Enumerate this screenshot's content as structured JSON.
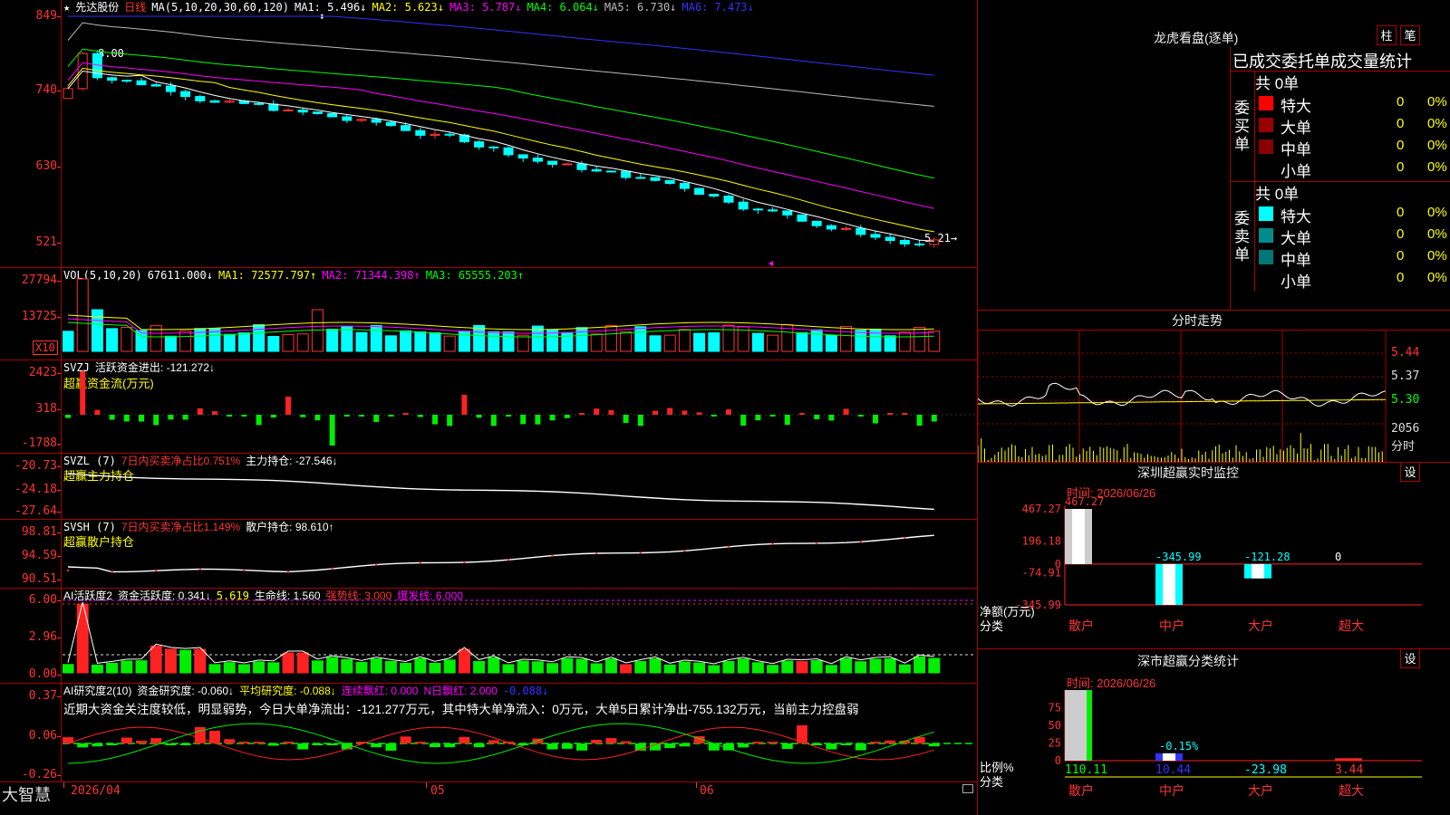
{
  "app": {
    "logo": "大智慧"
  },
  "main": {
    "star": "★",
    "stock": "先达股份",
    "period": "日线",
    "ma_def": "MA(5,10,20,30,60,120)",
    "ma1": "MA1: 5.496↓",
    "ma2": "MA2: 5.623↓",
    "ma3": "MA3: 5.787↓",
    "ma4": "MA4: 6.064↓",
    "ma5": "MA5: 6.730↓",
    "ma6": "MA6: 7.473↓",
    "y_labels": [
      "849",
      "740",
      "630",
      "521"
    ],
    "hi_label": "8.00",
    "lo_label": "5.21→",
    "marker": "⬍"
  },
  "vol": {
    "def": "VOL(5,10,20)",
    "cur": "67611.000↓",
    "ma1": "MA1: 72577.797↑",
    "ma2": "MA2: 71344.398↑",
    "ma3": "MA3: 65555.203↑",
    "y_labels": [
      "27794",
      "13725"
    ],
    "unit": "X10"
  },
  "svzj": {
    "def": "SVZJ",
    "label": "活跃资金进出: -121.272↓",
    "sub": "超赢资金流(万元)",
    "y_labels": [
      "2423",
      "318",
      "-1788"
    ]
  },
  "svzl": {
    "def": "SVZL (7)",
    "ratio": "7日内买卖净占比0.751%",
    "hold": "主力持仓: -27.546↓",
    "sub": "超赢主力持仓",
    "y_labels": [
      "-20.73",
      "-24.18",
      "-27.64"
    ]
  },
  "svsh": {
    "def": "SVSH (7)",
    "ratio": "7日内买卖净占比1.149%",
    "hold": "散户持仓: 98.610↑",
    "sub": "超赢散户持仓",
    "y_labels": [
      "98.81",
      "94.59",
      "90.51"
    ]
  },
  "ai1": {
    "def": "AI活跃度2",
    "a": "资金活跃度: 0.341↓",
    "b": "5.619",
    "c": "生命线: 1.560",
    "d": "强势线: 3.000",
    "e": "爆发线: 6.000",
    "y_labels": [
      "6.00",
      "2.96",
      "0.00"
    ]
  },
  "ai2": {
    "def": "AI研究度2(10)",
    "a": "资金研究度: -0.060↓",
    "b": "平均研究度: -0.088↓",
    "c": "连续飘红: 0.000",
    "d": "N日飘红: 2.000",
    "e": "-0.088↓",
    "comment": "近期大资金关注度较低，明显弱势，今日大单净流出：-121.277万元，其中特大单净流入：0万元，大单5日累计净出-755.132万元，当前主力控盘弱",
    "y_labels": [
      "0.37",
      "0.06",
      "-0.26"
    ]
  },
  "xaxis": {
    "labels": [
      "2026/04",
      "05",
      "06"
    ]
  },
  "right": {
    "lhb": {
      "title": "龙虎看盘(逐单)",
      "btn1": "柱",
      "btn2": "笔",
      "header": "已成交委托单成交量统计",
      "buy_side": "委买单",
      "sell_side": "委卖单",
      "buy_total": "共 0单",
      "sell_total": "共 0单",
      "buy_rows": [
        {
          "label": "特大",
          "count": "0",
          "pct": "0%"
        },
        {
          "label": "大单",
          "count": "0",
          "pct": "0%"
        },
        {
          "label": "中单",
          "count": "0",
          "pct": "0%"
        },
        {
          "label": "小单",
          "count": "0",
          "pct": "0%"
        }
      ],
      "sell_rows": [
        {
          "label": "特大",
          "count": "0",
          "pct": "0%"
        },
        {
          "label": "大单",
          "count": "0",
          "pct": "0%"
        },
        {
          "label": "中单",
          "count": "0",
          "pct": "0%"
        },
        {
          "label": "小单",
          "count": "0",
          "pct": "0%"
        }
      ],
      "colors": {
        "buy": [
          "#ff0000",
          "#990000",
          "#880000",
          "#000000"
        ],
        "sell": [
          "#00ffff",
          "#008b8b",
          "#007777",
          "#000000"
        ]
      }
    },
    "intraday": {
      "title": "分时走势",
      "y_labels": [
        "5.44",
        "5.37",
        "5.30"
      ],
      "vol_label": "2056",
      "unit": "分时"
    },
    "monitor": {
      "title": "深圳超赢实时监控",
      "set": "设",
      "time": "时间: 2026/06/26",
      "y_labels": [
        "467.27",
        "196.18",
        "0",
        "-74.91",
        "-345.99"
      ],
      "vals": [
        "467.27",
        "-345.99",
        "-121.28",
        "0"
      ],
      "values": [
        467.27,
        -345.99,
        -121.28,
        0
      ],
      "ylim": [
        -345.99,
        467.27
      ],
      "cats": [
        "散户",
        "中户",
        "大户",
        "超大"
      ],
      "axis1": "净额(万元)",
      "axis2": "分类"
    },
    "classify": {
      "title": "深市超赢分类统计",
      "set": "设",
      "time": "时间: 2026/06/26",
      "y_labels": [
        "75",
        "50",
        "25",
        "0"
      ],
      "bar_top": "-0.15%",
      "vals": [
        "110.11",
        "10.44",
        "-23.98",
        "3.44"
      ],
      "values": [
        110.11,
        10.44,
        -23.98,
        3.44
      ],
      "cats": [
        "散户",
        "中户",
        "大户",
        "超大"
      ],
      "axis1": "比例%",
      "axis2": "分类"
    }
  }
}
